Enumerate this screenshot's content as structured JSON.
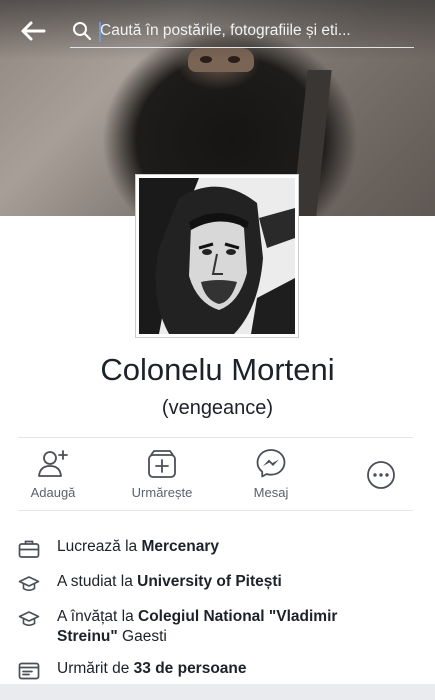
{
  "search": {
    "placeholder": "Caută în postările, fotografiile și eti..."
  },
  "profile": {
    "name": "Colonelu Morteni",
    "alternate_name": "(vengeance)"
  },
  "actions": [
    {
      "label": "Adaugă",
      "icon": "add-friend-icon"
    },
    {
      "label": "Urmărește",
      "icon": "follow-icon"
    },
    {
      "label": "Mesaj",
      "icon": "messenger-icon"
    },
    {
      "label": "",
      "icon": "more-icon"
    }
  ],
  "info": {
    "work": {
      "prefix": "Lucrează la ",
      "value": "Mercenary",
      "icon": "briefcase-icon"
    },
    "studied": {
      "prefix": "A studiat la ",
      "value": "University of Pitești",
      "icon": "graduation-cap-icon"
    },
    "learned": {
      "prefix": "A învățat la ",
      "value": "Colegiul National \"Vladimir Streinu\"",
      "suffix": " Gaesti",
      "icon": "graduation-cap-icon"
    },
    "followers": {
      "prefix": "Urmărit de ",
      "value": "33 de persoane",
      "icon": "followers-icon"
    }
  },
  "colors": {
    "text": "#1d2129",
    "secondary_text": "#5b616c",
    "icon": "#4b4f56"
  }
}
